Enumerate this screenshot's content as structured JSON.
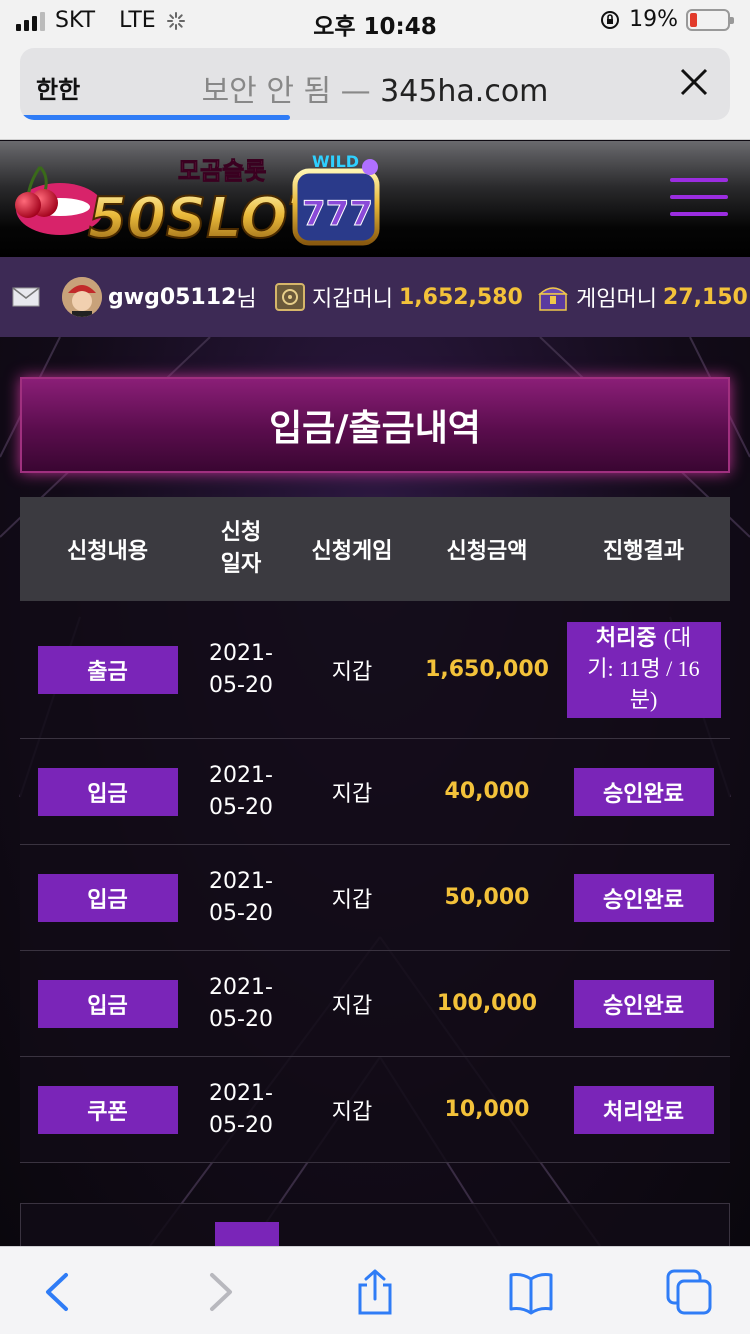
{
  "status_bar": {
    "carrier": "SKT",
    "network": "LTE",
    "time": "오후 10:48",
    "battery_percent": "19%",
    "battery_level": 0.19
  },
  "url_bar": {
    "reader_label": "한한",
    "insecure_label": "보안 안 됨 —",
    "domain": "345ha.com",
    "load_progress": 0.38
  },
  "site": {
    "logo_korean": "모곰슬롯",
    "logo_main": "50SLOT",
    "logo_badge": "WILD",
    "logo_reel": "777"
  },
  "user": {
    "username": "gwg05112",
    "suffix": "님",
    "wallet_label": "지갑머니",
    "wallet_amount": "1,652,580",
    "game_label": "게임머니",
    "game_amount": "27,150"
  },
  "page": {
    "title": "입금/출금내역"
  },
  "table": {
    "headers": {
      "type": "신청내용",
      "date_line1": "신청",
      "date_line2": "일자",
      "game": "신청게임",
      "amount": "신청금액",
      "result": "진행결과"
    },
    "rows": [
      {
        "type": "출금",
        "date_line1": "2021-",
        "date_line2": "05-20",
        "game": "지갑",
        "amount": "1,650,000",
        "result_bold": "처리중",
        "result_rest_1": "(대",
        "result_rest_2": "기: 11명 / 16",
        "result_rest_3": "분)"
      },
      {
        "type": "입금",
        "date_line1": "2021-",
        "date_line2": "05-20",
        "game": "지갑",
        "amount": "40,000",
        "result": "승인완료"
      },
      {
        "type": "입금",
        "date_line1": "2021-",
        "date_line2": "05-20",
        "game": "지갑",
        "amount": "50,000",
        "result": "승인완료"
      },
      {
        "type": "입금",
        "date_line1": "2021-",
        "date_line2": "05-20",
        "game": "지갑",
        "amount": "100,000",
        "result": "승인완료"
      },
      {
        "type": "쿠폰",
        "date_line1": "2021-",
        "date_line2": "05-20",
        "game": "지갑",
        "amount": "10,000",
        "result": "처리완료"
      }
    ]
  },
  "icons": {
    "mail": "mail-icon",
    "wallet": "safe-icon",
    "game": "treasure-chest-icon",
    "back": "chevron-left-icon",
    "forward": "chevron-right-icon",
    "share": "share-icon",
    "bookmarks": "book-icon",
    "tabs": "tabs-icon"
  },
  "colors": {
    "accent_purple": "#7a25b8",
    "gold": "#f3c23a",
    "user_bar": "#3d2a55"
  }
}
